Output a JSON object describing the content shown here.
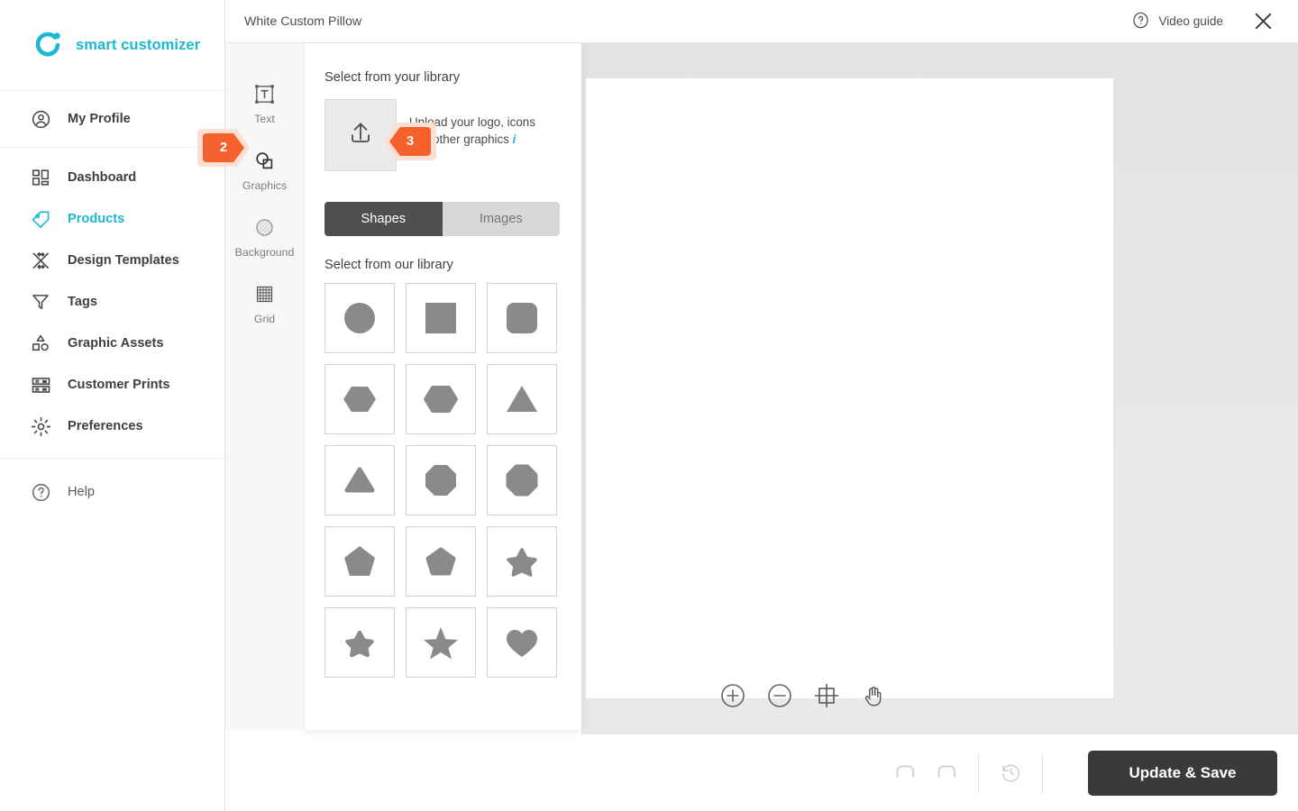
{
  "brand": {
    "name": "smart customizer",
    "color": "#1cb8d1",
    "logo_icon": "circle-dot-logo"
  },
  "sidebar": {
    "profile": {
      "label": "My Profile",
      "icon": "user-circle-icon"
    },
    "items": [
      {
        "label": "Dashboard",
        "icon": "dashboard-grid-icon",
        "active": false
      },
      {
        "label": "Products",
        "icon": "tag-icon",
        "active": true
      },
      {
        "label": "Design Templates",
        "icon": "design-templates-icon",
        "active": false
      },
      {
        "label": "Tags",
        "icon": "funnel-icon",
        "active": false
      },
      {
        "label": "Graphic Assets",
        "icon": "graphic-assets-icon",
        "active": false
      },
      {
        "label": "Customer Prints",
        "icon": "customer-prints-icon",
        "active": false
      },
      {
        "label": "Preferences",
        "icon": "gear-icon",
        "active": false
      }
    ],
    "help": {
      "label": "Help",
      "icon": "question-circle-icon"
    }
  },
  "topbar": {
    "title": "White Custom Pillow",
    "video_guide_label": "Video guide",
    "video_guide_icon": "question-circle-icon",
    "close_icon": "close-icon"
  },
  "toolrail": {
    "tools": [
      {
        "label": "Text",
        "icon": "text-box-icon",
        "active": false
      },
      {
        "label": "Graphics",
        "icon": "graphics-shapes-icon",
        "active": true
      },
      {
        "label": "Background",
        "icon": "checkerboard-circle-icon",
        "active": false
      },
      {
        "label": "Grid",
        "icon": "grid-icon",
        "active": false
      }
    ]
  },
  "panel": {
    "library_heading": "Select from your library",
    "upload_icon": "upload-arrow-icon",
    "upload_text_line1": "Upload your logo, icons",
    "upload_text_line2": "and other graphics",
    "info_icon": "info-italic-icon",
    "segmented": {
      "shapes_label": "Shapes",
      "images_label": "Images",
      "selected": "Shapes"
    },
    "our_library_heading": "Select from our library",
    "shapes": [
      {
        "name": "circle"
      },
      {
        "name": "square"
      },
      {
        "name": "rounded-square"
      },
      {
        "name": "hexagon-flat-top"
      },
      {
        "name": "hexagon-pointy-top"
      },
      {
        "name": "triangle"
      },
      {
        "name": "triangle-rounded"
      },
      {
        "name": "octagon"
      },
      {
        "name": "octagon-rounded"
      },
      {
        "name": "pentagon"
      },
      {
        "name": "pentagon-rounded"
      },
      {
        "name": "star-rounded-small"
      },
      {
        "name": "star-rounded"
      },
      {
        "name": "star-sharp"
      },
      {
        "name": "heart"
      }
    ]
  },
  "badges": [
    {
      "number": "2",
      "direction": "right",
      "target": "graphics-tool"
    },
    {
      "number": "3",
      "direction": "left",
      "target": "upload-box"
    }
  ],
  "canvas_tools": [
    {
      "name": "zoom-in-icon"
    },
    {
      "name": "zoom-out-icon"
    },
    {
      "name": "fit-to-frame-icon"
    },
    {
      "name": "pan-hand-icon"
    }
  ],
  "bottombar": {
    "undo_icon": "undo-icon",
    "redo_icon": "redo-icon",
    "history_icon": "history-clock-icon",
    "save_label": "Update & Save",
    "save_color": "#3a3a3a"
  }
}
